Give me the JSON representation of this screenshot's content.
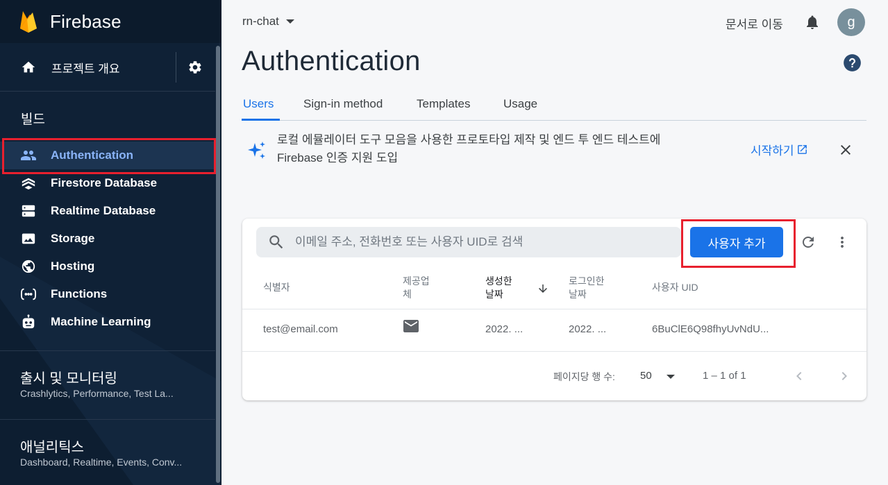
{
  "brand": {
    "name": "Firebase"
  },
  "sidebar": {
    "overview_label": "프로젝트 개요",
    "section_build": "빌드",
    "items": [
      {
        "label": "Authentication",
        "icon": "people-icon",
        "active": true
      },
      {
        "label": "Firestore Database",
        "icon": "firestore-icon"
      },
      {
        "label": "Realtime Database",
        "icon": "database-icon"
      },
      {
        "label": "Storage",
        "icon": "storage-icon"
      },
      {
        "label": "Hosting",
        "icon": "hosting-icon"
      },
      {
        "label": "Functions",
        "icon": "functions-icon"
      },
      {
        "label": "Machine Learning",
        "icon": "robot-icon"
      }
    ],
    "release": {
      "title": "출시 및 모니터링",
      "sub": "Crashlytics, Performance, Test La..."
    },
    "analytics": {
      "title": "애널리틱스",
      "sub": "Dashboard, Realtime, Events, Conv..."
    }
  },
  "header": {
    "project": "rn-chat",
    "docs": "문서로 이동",
    "avatar_letter": "g",
    "title": "Authentication"
  },
  "tabs": [
    "Users",
    "Sign-in method",
    "Templates",
    "Usage"
  ],
  "banner": {
    "line1": "로컬 에뮬레이터 도구 모음을 사용한 프로토타입 제작 및 엔드 투 엔드 테스트에",
    "line2": "Firebase 인증 지원 도입",
    "cta": "시작하기"
  },
  "users": {
    "search_placeholder": "이메일 주소, 전화번호 또는 사용자 UID로 검색",
    "add_button": "사용자 추가",
    "columns": {
      "identifier": "식별자",
      "provider_1": "제공업",
      "provider_2": "체",
      "created_1": "생성한",
      "created_2": "날짜",
      "signedin_1": "로그인한",
      "signedin_2": "날짜",
      "uid": "사용자 UID"
    },
    "rows": [
      {
        "identifier": "test@email.com",
        "provider": "email-icon",
        "created": "2022. ...",
        "signed_in": "2022. ...",
        "uid": "6BuClE6Q98fhyUvNdU..."
      }
    ],
    "pager": {
      "rows_per_page_label": "페이지당 행 수:",
      "rows_per_page": "50",
      "range": "1 – 1 of 1"
    }
  },
  "colors": {
    "accent": "#1a73e8",
    "sidebar_bg": "#0f2136",
    "highlight": "#e8202e"
  }
}
